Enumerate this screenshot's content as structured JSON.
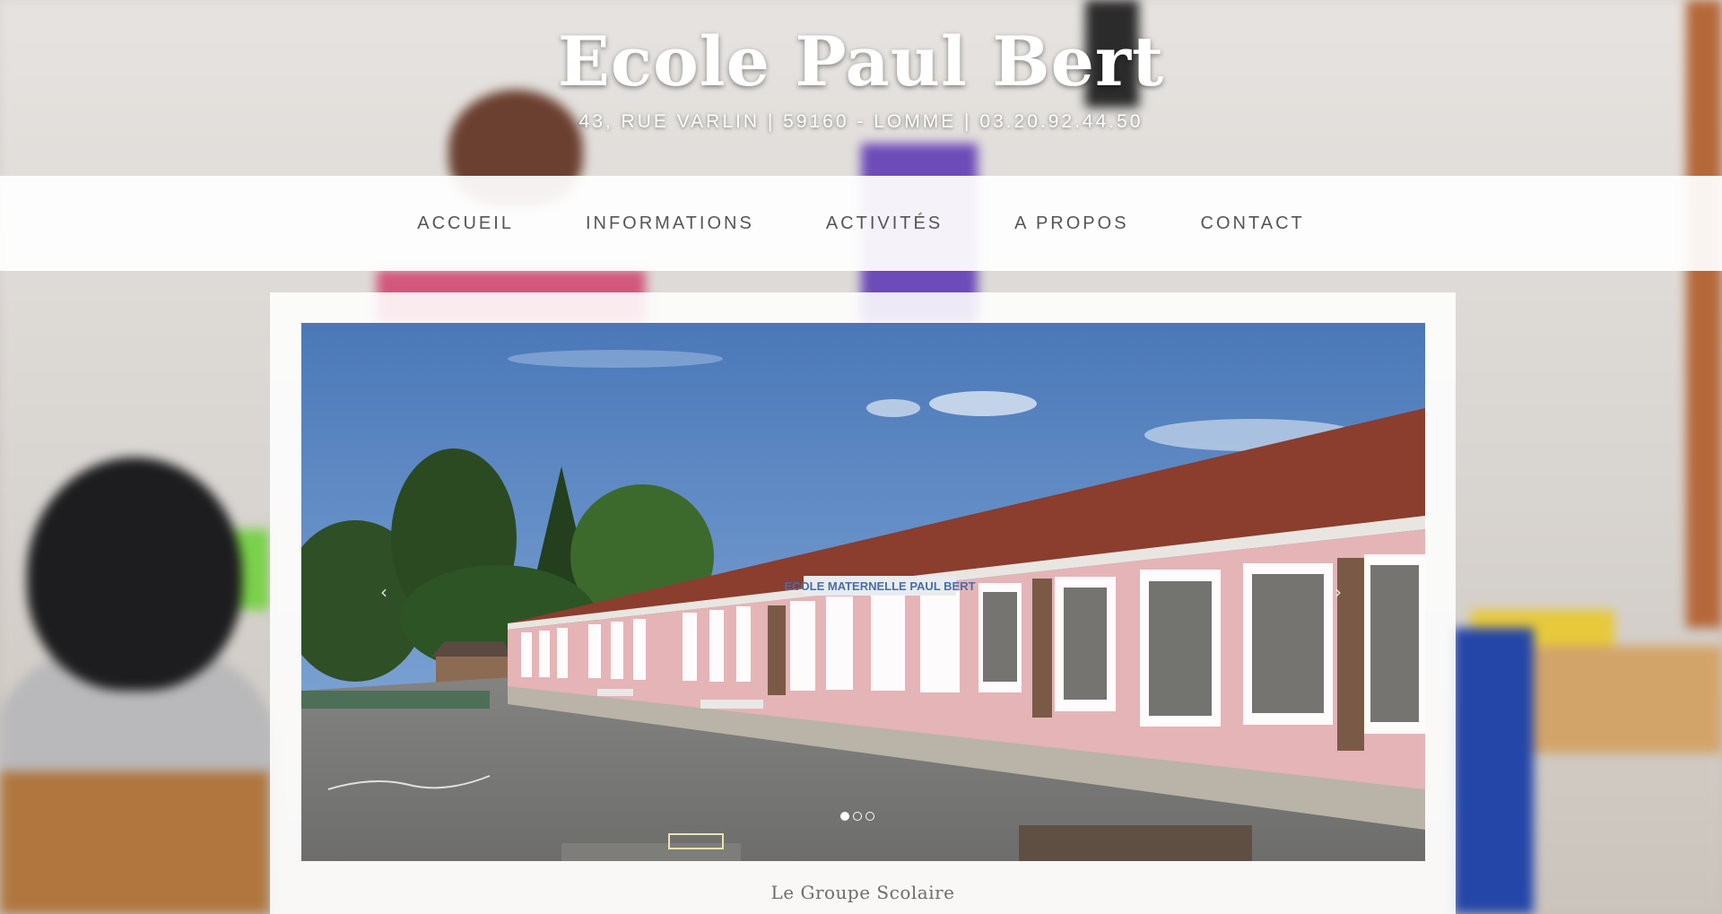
{
  "header": {
    "title": "Ecole Paul Bert",
    "address": "43, RUE VARLIN | 59160 - LOMME | 03.20.92.44.50"
  },
  "nav": {
    "items": [
      {
        "label": "ACCUEIL"
      },
      {
        "label": "INFORMATIONS"
      },
      {
        "label": "ACTIVITÉS"
      },
      {
        "label": "A PROPOS"
      },
      {
        "label": "CONTACT"
      }
    ]
  },
  "slider": {
    "building_sign": "ECOLE MATERNELLE PAUL BERT",
    "prev_icon": "chevron-left-icon",
    "next_icon": "chevron-right-icon",
    "prev_glyph": "‹",
    "next_glyph": "›",
    "slide_count": 3,
    "active_slide": 1,
    "caption": "Le Groupe Scolaire"
  },
  "colors": {
    "nav_text": "#555555",
    "caption_text": "#6d6d6d",
    "title_text": "#ffffff"
  }
}
